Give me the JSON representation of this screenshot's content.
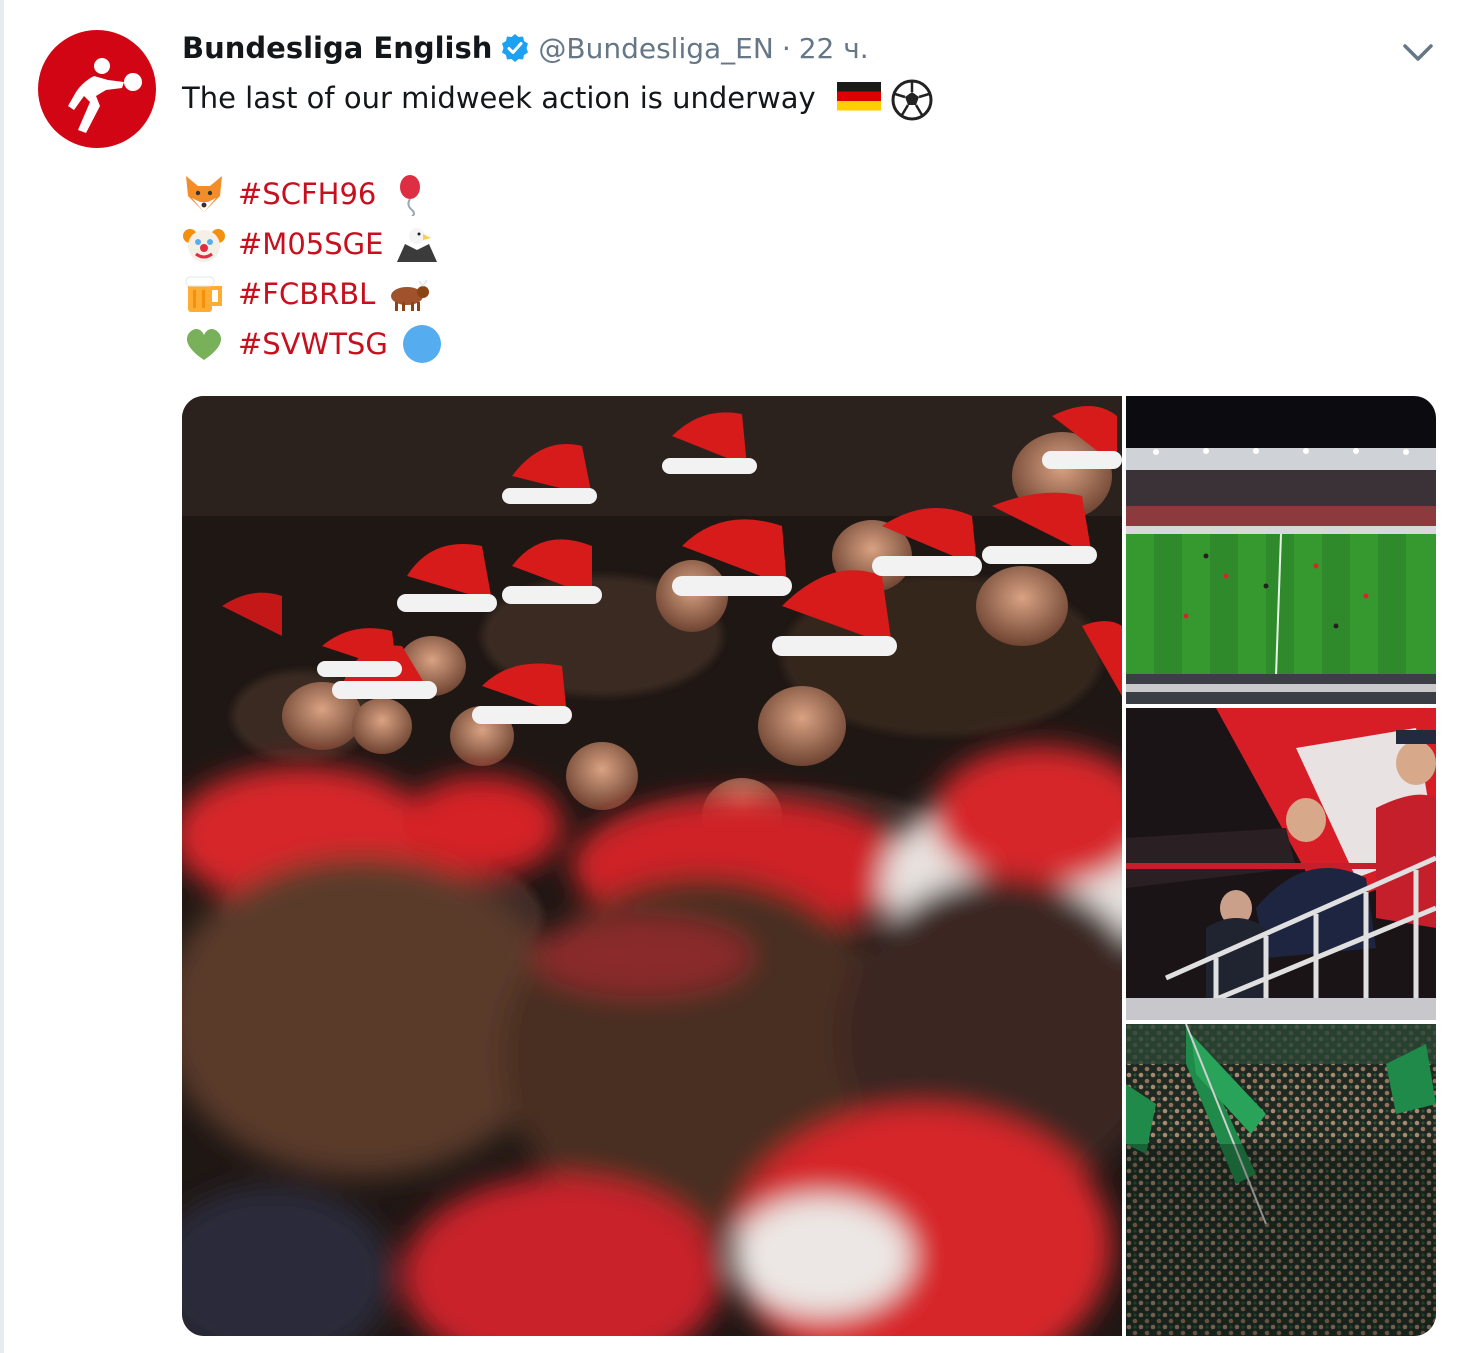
{
  "tweet": {
    "author_name": "Bundesliga English",
    "handle": "@Bundesliga_EN",
    "separator": "·",
    "time": "22 ч.",
    "text": "The last of our midweek action is underway",
    "text_emojis": [
      "germany-flag-icon",
      "soccer-ball-icon"
    ],
    "hashtag_lines": [
      {
        "leading_icon": "fox-icon",
        "hashtag": "#SCFH96",
        "trailing_icon": "balloon-icon"
      },
      {
        "leading_icon": "clown-face-icon",
        "hashtag": "#M05SGE",
        "trailing_icon": "eagle-icon"
      },
      {
        "leading_icon": "beer-mug-icon",
        "hashtag": "#FCBRBL",
        "trailing_icon": "bull-icon"
      },
      {
        "leading_icon": "green-heart-icon",
        "hashtag": "#SVWTSG",
        "trailing_icon": "blue-circle-icon"
      }
    ],
    "photos": [
      "crowd-in-santa-hats-photo",
      "stadium-pitch-photo",
      "fans-with-flag-photo",
      "green-fans-crowd-photo"
    ]
  },
  "colors": {
    "name": "#14171a",
    "meta": "#657786",
    "hashtag": "#c80f1e",
    "verified": "#1da1f2",
    "brand_red": "#d20515"
  }
}
